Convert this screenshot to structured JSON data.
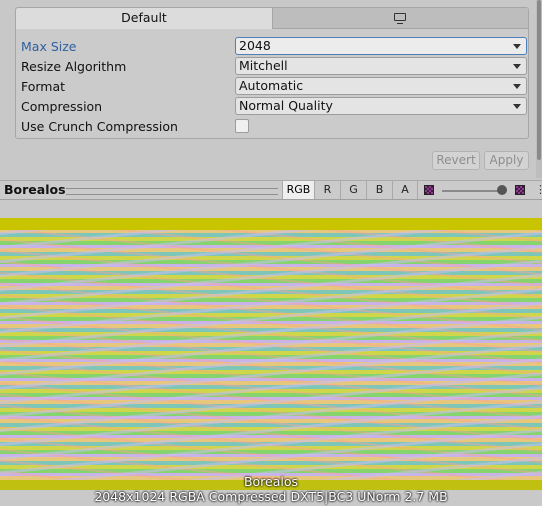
{
  "tabs": {
    "default_label": "Default",
    "platform_icon": "monitor-icon"
  },
  "settings": [
    {
      "label": "Max Size",
      "value": "2048"
    },
    {
      "label": "Resize Algorithm",
      "value": "Mitchell"
    },
    {
      "label": "Format",
      "value": "Automatic"
    },
    {
      "label": "Compression",
      "value": "Normal Quality"
    },
    {
      "label": "Use Crunch Compression",
      "checked": false
    }
  ],
  "actions": {
    "revert_label": "Revert",
    "apply_label": "Apply"
  },
  "preview_toolbar": {
    "title": "Borealos",
    "channels": [
      "RGB",
      "R",
      "G",
      "B",
      "A"
    ],
    "selected_channel": "RGB"
  },
  "preview": {
    "name": "Borealos",
    "info": "2048x1024  RGBA Compressed DXT5|BC3 UNorm   2.7 MB"
  }
}
